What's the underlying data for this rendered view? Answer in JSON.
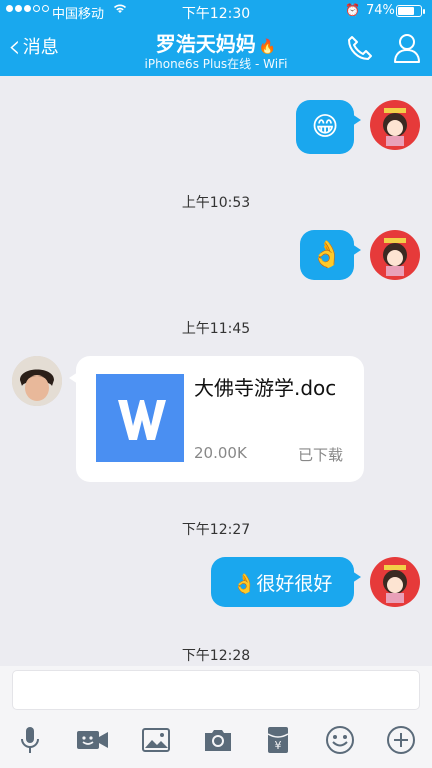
{
  "status_bar": {
    "carrier": "中国移动",
    "time": "下午12:30",
    "battery_text": "74%",
    "battery_level": 0.74
  },
  "header": {
    "back_label": "消息",
    "contact_name": "罗浩天妈妈",
    "contact_status": "iPhone6s Plus在线 - WiFi"
  },
  "messages": {
    "msg1_emoji": "😁",
    "ts1": "上午10:53",
    "msg2_emoji": "👌",
    "ts2": "上午11:45",
    "file": {
      "name": "大佛寺游学.doc",
      "size": "20.00K",
      "status": "已下载"
    },
    "ts3": "下午12:27",
    "msg3_text": "👌很好很好",
    "ts4": "下午12:28"
  },
  "colors": {
    "accent": "#19a8ee",
    "bubble": "#1aa7ee",
    "background": "#ececf1"
  },
  "toolbar_icons": [
    "microphone-icon",
    "video-icon",
    "image-icon",
    "camera-icon",
    "red-packet-icon",
    "emoji-icon",
    "plus-icon"
  ]
}
